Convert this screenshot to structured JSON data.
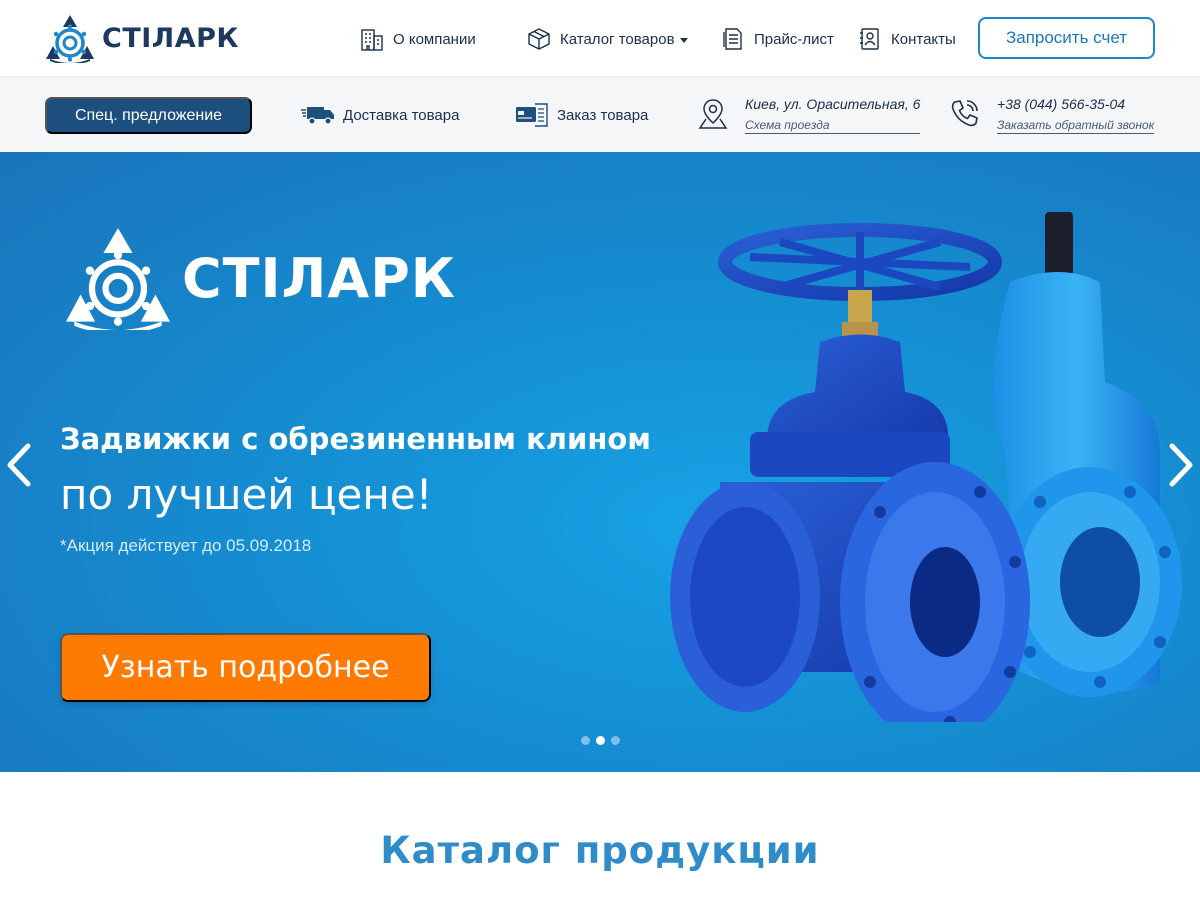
{
  "brand": {
    "name": "СТІЛАРК",
    "primary_color": "#1c4e7e",
    "accent_color": "#1f86c8",
    "cta_color": "#ff7a00"
  },
  "header": {
    "nav": [
      {
        "label": "О компании",
        "icon": "building-icon"
      },
      {
        "label": "Каталог товаров",
        "icon": "box-icon",
        "has_dropdown": true
      },
      {
        "label": "Прайс-лист",
        "icon": "document-icon"
      },
      {
        "label": "Контакты",
        "icon": "contacts-icon"
      }
    ],
    "request_button": "Запросить счет"
  },
  "subbar": {
    "special_offer": "Спец. предложение",
    "delivery": {
      "label": "Доставка товара",
      "icon": "truck-icon"
    },
    "order": {
      "label": "Заказ товара",
      "icon": "order-card-icon"
    },
    "address": {
      "text": "Киев, ул. Орасительная, 6",
      "link": "Схема проезда",
      "icon": "map-pin-icon"
    },
    "phone": {
      "text": "+38 (044) 566-35-04",
      "link": "Заказать обратный звонок",
      "icon": "phone-icon"
    }
  },
  "hero": {
    "logo_text": "СТІЛАРК",
    "title_line1": "Задвижки с обрезиненным клином",
    "title_line2": "по лучшей цене!",
    "note": "*Акция действует до 05.09.2018",
    "cta": "Узнать подробнее",
    "slides_total": 3,
    "active_slide": 2,
    "image": "blue-gate-valves-illustration"
  },
  "catalog": {
    "title": "Каталог продукции"
  }
}
